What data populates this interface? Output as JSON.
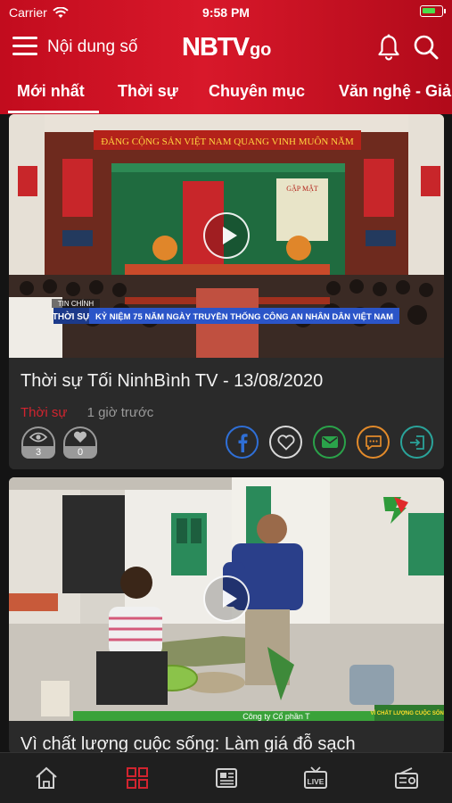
{
  "status_bar": {
    "carrier": "Carrier",
    "time": "9:58 PM"
  },
  "header": {
    "title": "Nội dung số",
    "logo_text_main": "NBTV",
    "logo_text_sub": "go",
    "icons": [
      "menu-icon",
      "bell-icon",
      "search-icon"
    ]
  },
  "tabs": [
    {
      "label": "Mới nhất",
      "active": true
    },
    {
      "label": "Thời sự",
      "active": false
    },
    {
      "label": "Chuyên mục",
      "active": false
    },
    {
      "label": "Văn nghệ - Giả",
      "active": false
    }
  ],
  "cards": [
    {
      "title": "Thời sự Tối NinhBình TV - 13/08/2020",
      "category": "Thời sự",
      "time_ago": "1 giờ trước",
      "views": "3",
      "likes": "0",
      "thumb_banner": "ĐẢNG CỘNG SẢN VIỆT NAM QUANG VINH MUÔN NĂM",
      "thumb_sign": "GẶP MẶT",
      "thumb_program_label": "TIN CHÍNH",
      "thumb_program": "THỜI SỰ",
      "thumb_caption": "KỶ NIỆM 75 NĂM NGÀY TRUYỀN THỐNG CÔNG AN NHÂN DÂN VIỆT NAM"
    },
    {
      "title": "Vì chất lượng cuộc sống: Làm giá đỗ sạch",
      "thumb_ticker": "Công ty Cổ phần T",
      "thumb_ticker_tag": "VÌ CHẤT LƯỢNG CUỘC SỐNG"
    }
  ],
  "colors": {
    "header_red": "#d8182a",
    "category_red": "#d2242f",
    "facebook_blue": "#2f6fd6",
    "mail_green": "#2aa34a",
    "comment_orange": "#e28a2a",
    "share_teal": "#2aa39a",
    "bottom_active": "#d2242f"
  },
  "bottom_nav": [
    "home-icon",
    "grid-icon",
    "news-icon",
    "live-icon",
    "radio-icon"
  ]
}
